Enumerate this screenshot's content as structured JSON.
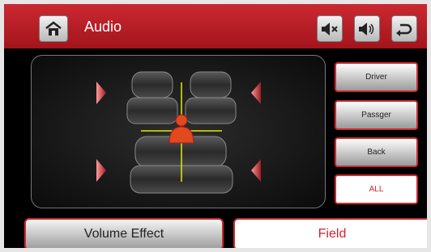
{
  "header": {
    "title": "Audio",
    "icons": [
      "home-icon",
      "mute-icon",
      "volume-icon",
      "back-icon"
    ]
  },
  "side_buttons": {
    "driver": "Driver",
    "passenger": "Passger",
    "back": "Back",
    "all": "ALL"
  },
  "bottom_tabs": {
    "volume_effect": "Volume Effect",
    "field": "Field"
  },
  "colors": {
    "accent": "#d61f2a",
    "header_red": "#c0232b",
    "listener": "#e04a1c",
    "crosshair": "#e8e800"
  }
}
